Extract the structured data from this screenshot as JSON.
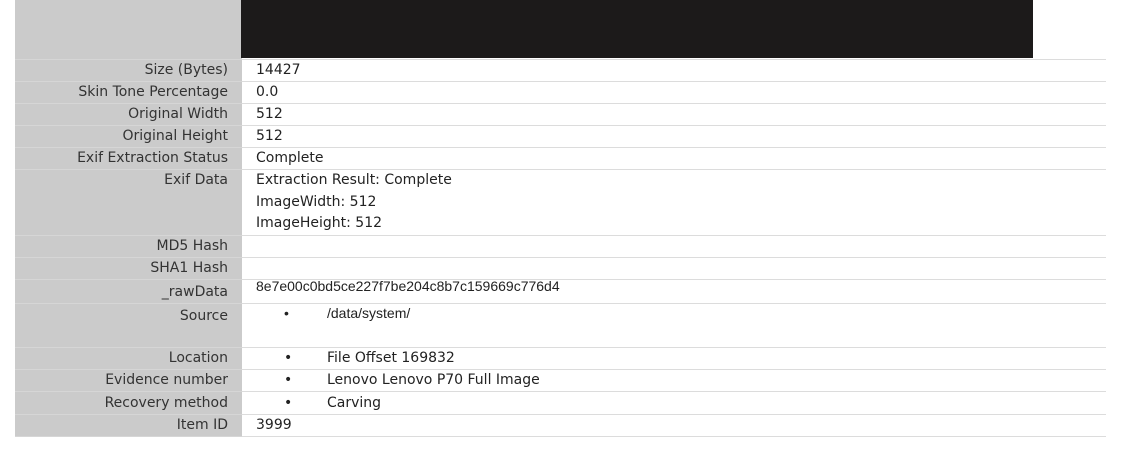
{
  "rows": {
    "size_bytes": {
      "label": "Size (Bytes)",
      "value": "14427"
    },
    "skin_tone": {
      "label": "Skin Tone Percentage",
      "value": "0.0"
    },
    "orig_width": {
      "label": "Original Width",
      "value": "512"
    },
    "orig_height": {
      "label": "Original Height",
      "value": "512"
    },
    "exif_status": {
      "label": "Exif Extraction Status",
      "value": "Complete"
    },
    "exif_data": {
      "label": "Exif Data",
      "lines": [
        "Extraction Result: Complete",
        "ImageWidth: 512",
        "ImageHeight: 512"
      ]
    },
    "md5": {
      "label": "MD5 Hash",
      "value": ""
    },
    "sha1": {
      "label": "SHA1 Hash",
      "value": ""
    },
    "raw_data": {
      "label": "_rawData",
      "value": "8e7e00c0bd5ce227f7be204c8b7c159669c776d4"
    },
    "source": {
      "label": "Source",
      "value": "/data/system/"
    },
    "location": {
      "label": "Location",
      "value": "File Offset 169832"
    },
    "evidence": {
      "label": "Evidence number",
      "value": "Lenovo Lenovo P70 Full Image"
    },
    "recovery": {
      "label": "Recovery method",
      "value": "Carving"
    },
    "item_id": {
      "label": "Item ID",
      "value": "3999"
    }
  },
  "bullet_char": "•"
}
